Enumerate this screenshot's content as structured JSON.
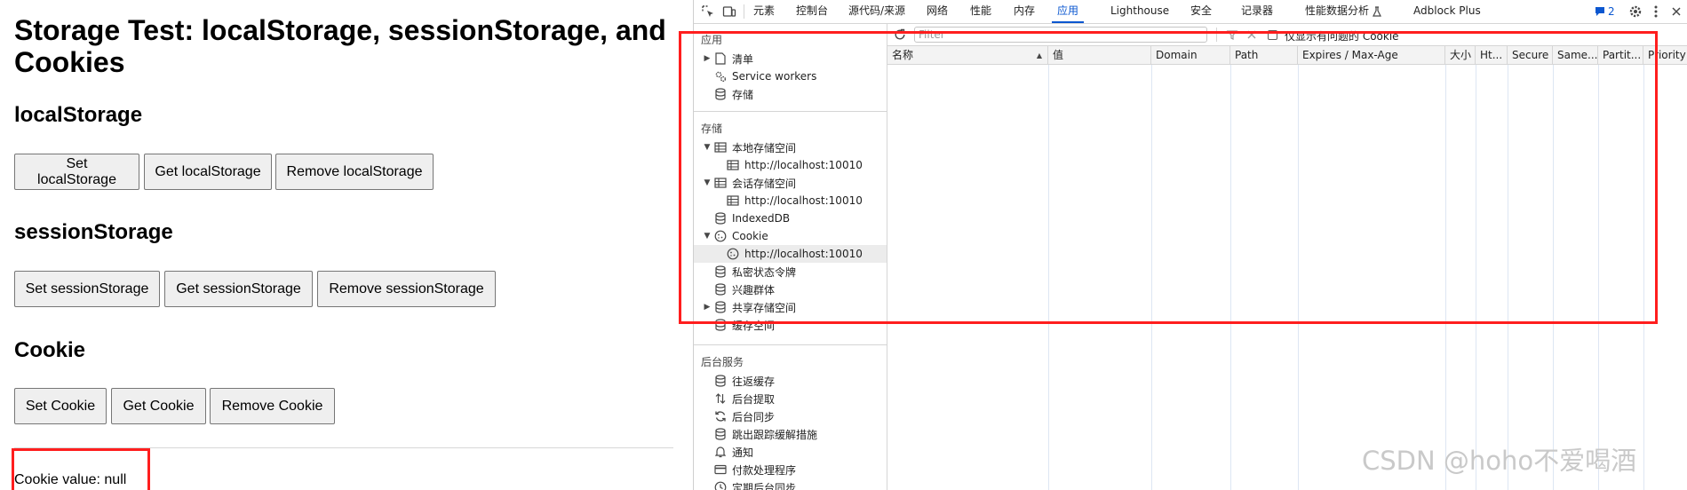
{
  "page": {
    "title": "Storage Test: localStorage, sessionStorage, and Cookies",
    "local": {
      "heading": "localStorage",
      "set": "Set localStorage",
      "get": "Get localStorage",
      "remove": "Remove localStorage"
    },
    "session": {
      "heading": "sessionStorage",
      "set": "Set sessionStorage",
      "get": "Get sessionStorage",
      "remove": "Remove sessionStorage"
    },
    "cookie": {
      "heading": "Cookie",
      "set": "Set Cookie",
      "get": "Get Cookie",
      "remove": "Remove Cookie"
    },
    "result": "Cookie value: null"
  },
  "devtools": {
    "tabs": [
      "元素",
      "控制台",
      "源代码/来源",
      "网络",
      "性能",
      "内存",
      "应用",
      "Lighthouse",
      "安全",
      "记录器",
      "性能数据分析",
      "Adblock Plus"
    ],
    "active_tab": "应用",
    "issues_count": "2",
    "sidebar": {
      "app_title": "应用",
      "app_items": [
        "清单",
        "Service workers",
        "存储"
      ],
      "storage_title": "存储",
      "storage_items": [
        "本地存储空间",
        "http://localhost:10010",
        "会话存储空间",
        "http://localhost:10010",
        "IndexedDB",
        "Cookie",
        "http://localhost:10010",
        "私密状态令牌",
        "兴趣群体",
        "共享存储空间",
        "缓存空间"
      ],
      "bg_title": "后台服务",
      "bg_items": [
        "往返缓存",
        "后台提取",
        "后台同步",
        "跳出跟踪缓解措施",
        "通知",
        "付款处理程序",
        "定期后台同步"
      ]
    },
    "toolbar": {
      "filter_placeholder": "Filter",
      "only_issues_label": "仅显示有问题的 Cookie"
    },
    "columns": [
      "名称",
      "值",
      "Domain",
      "Path",
      "Expires / Max-Age",
      "大小",
      "Ht...",
      "Secure",
      "Same...",
      "Partit...",
      "Priority"
    ]
  },
  "watermark": "CSDN @hoho不爱喝酒",
  "colors": {
    "highlight_border": "#ff1e1e",
    "active_tab": "#0b57d0",
    "selected_row": "#ececec"
  }
}
